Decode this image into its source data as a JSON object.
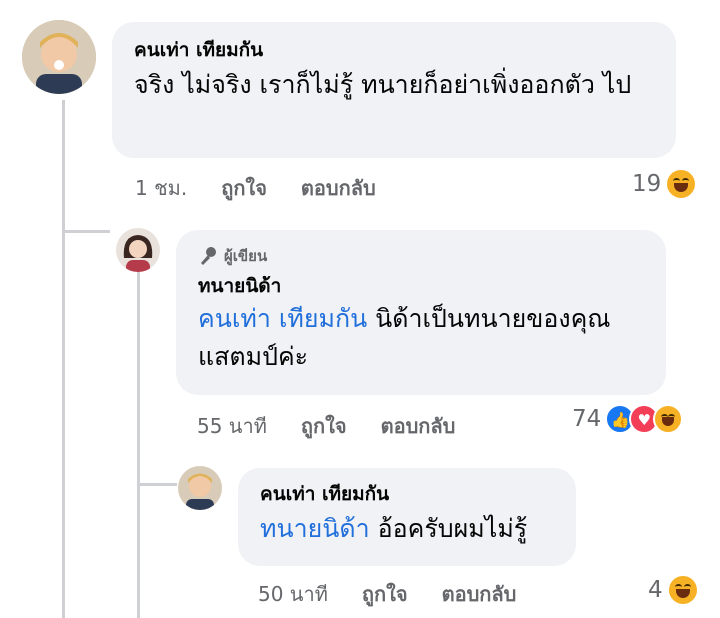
{
  "comments": [
    {
      "author": "คนเท่า เทียมกัน",
      "text": "จริง ไม่จริง เราก็ไม่รู้ ทนายก็อย่าเพิ่งออกตัว ไป",
      "time": "1 ชม.",
      "like_label": "ถูกใจ",
      "reply_label": "ตอบกลับ",
      "reaction_count": "19",
      "reactions": [
        "haha"
      ]
    },
    {
      "badge": "ผู้เขียน",
      "author": "ทนายนิด้า",
      "mention": "คนเท่า เทียมกัน",
      "text": " นิด้าเป็นทนายของคุณแสตมป์ค่ะ",
      "time": "55 นาที",
      "like_label": "ถูกใจ",
      "reply_label": "ตอบกลับ",
      "reaction_count": "74",
      "reactions": [
        "like",
        "love",
        "haha"
      ]
    },
    {
      "author": "คนเท่า เทียมกัน",
      "mention": "ทนายนิด้า",
      "text": " อ้อครับผมไม่รู้",
      "time": "50 นาที",
      "like_label": "ถูกใจ",
      "reply_label": "ตอบกลับ",
      "reaction_count": "4",
      "reactions": [
        "haha"
      ]
    }
  ],
  "colors": {
    "bubble": "#f0f2f5",
    "mention": "#216fdb",
    "meta": "#65676b",
    "line": "#ced0d4"
  }
}
